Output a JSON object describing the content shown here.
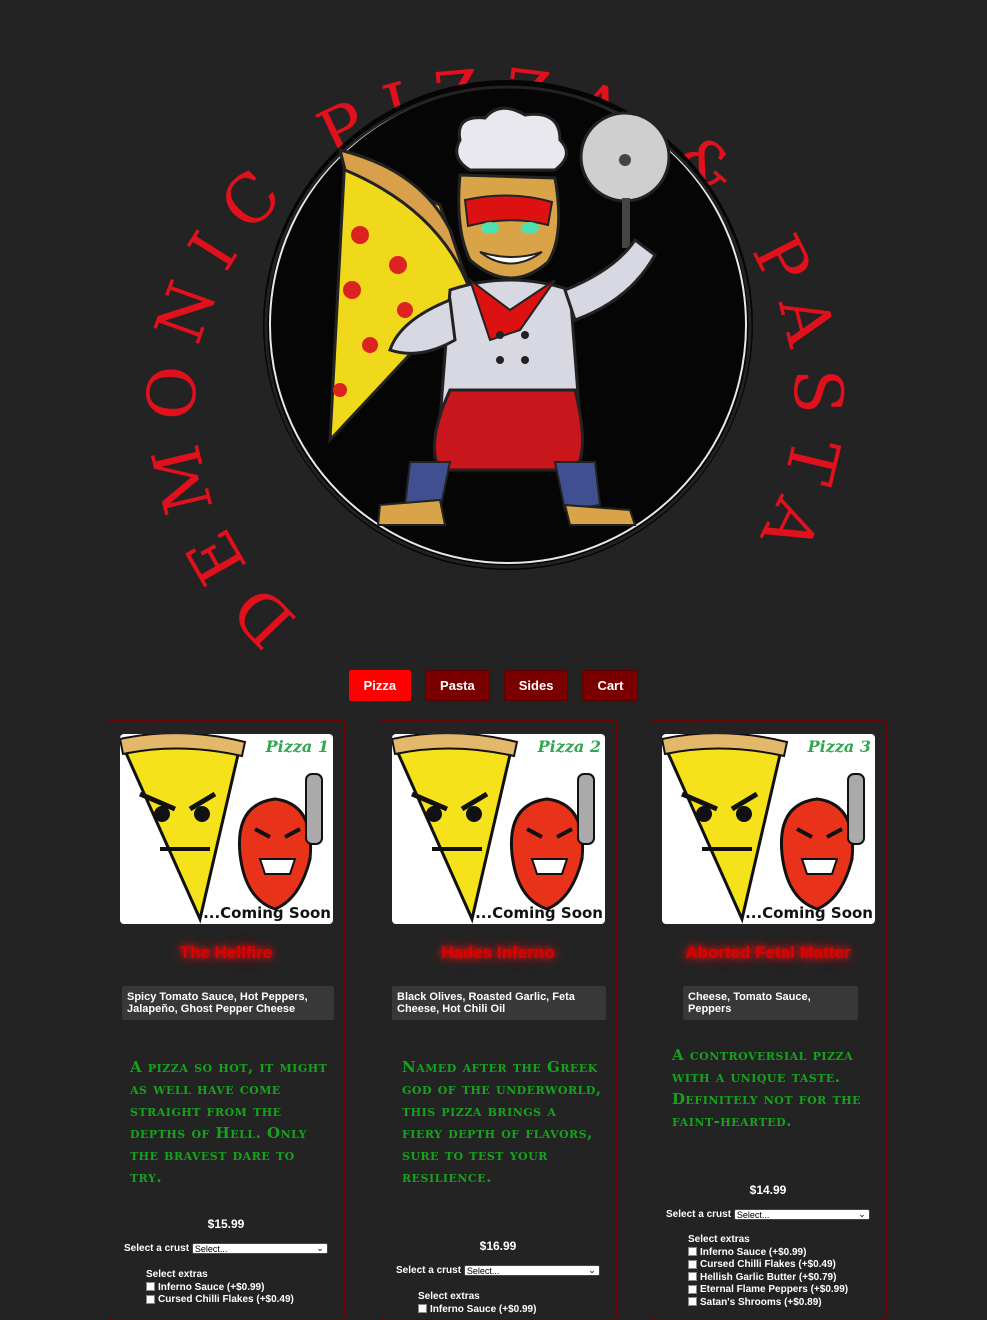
{
  "logo": {
    "circle_text": "DEMONIC PIZZA & PASTA",
    "brand_red": "#e0111c"
  },
  "nav": {
    "items": [
      {
        "label": "Pizza",
        "active": true
      },
      {
        "label": "Pasta",
        "active": false
      },
      {
        "label": "Sides",
        "active": false
      },
      {
        "label": "Cart",
        "active": false
      }
    ]
  },
  "products": [
    {
      "image_label": "Pizza 1",
      "image_caption": "...Coming Soon",
      "name": "The Hellfire",
      "ingredients": "Spicy Tomato Sauce, Hot Peppers, Jalapeño, Ghost Pepper Cheese",
      "description": "A pizza so hot, it might as well have come straight from the depths of Hell. Only the bravest dare to try.",
      "price": "$15.99",
      "crust_label": "Select a crust",
      "crust_value": "Select...",
      "extras_title": "Select extras",
      "extras": [
        "Inferno Sauce (+$0.99)",
        "Cursed Chilli Flakes (+$0.49)"
      ]
    },
    {
      "image_label": "Pizza 2",
      "image_caption": "...Coming Soon",
      "name": "Hades Inferno",
      "ingredients": "Black Olives, Roasted Garlic, Feta Cheese, Hot Chili Oil",
      "description": "Named after the Greek god of the underworld, this pizza brings a fiery depth of flavors, sure to test your resilience.",
      "price": "$16.99",
      "crust_label": "Select a crust",
      "crust_value": "Select...",
      "extras_title": "Select extras",
      "extras": [
        "Inferno Sauce (+$0.99)"
      ]
    },
    {
      "image_label": "Pizza 3",
      "image_caption": "...Coming Soon",
      "name": "Aborted Fetal Matter",
      "ingredients": "Cheese, Tomato Sauce, Peppers",
      "description": "A controversial pizza with a unique taste. Definitely not for the faint-hearted.",
      "price": "$14.99",
      "crust_label": "Select a crust",
      "crust_value": "Select...",
      "extras_title": "Select extras",
      "extras": [
        "Inferno Sauce (+$0.99)",
        "Cursed Chilli Flakes (+$0.49)",
        "Hellish Garlic Butter (+$0.79)",
        "Eternal Flame Peppers (+$0.99)",
        "Satan's Shrooms (+$0.89)"
      ]
    }
  ]
}
